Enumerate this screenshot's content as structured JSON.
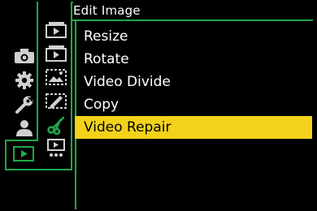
{
  "header": {
    "title": "Edit Image"
  },
  "menu": {
    "items": [
      {
        "label": "Resize"
      },
      {
        "label": "Rotate"
      },
      {
        "label": "Video Divide"
      },
      {
        "label": "Copy"
      },
      {
        "label": "Video Repair"
      }
    ],
    "selected_index": 4
  },
  "left_tabs": [
    {
      "icon": "camera-icon"
    },
    {
      "icon": "gear-icon"
    },
    {
      "icon": "wrench-icon"
    },
    {
      "icon": "person-icon"
    },
    {
      "icon": "playback-icon",
      "active": true
    }
  ],
  "sub_tabs": [
    {
      "icon": "film-stack-icon"
    },
    {
      "icon": "film-stack-alt-icon"
    },
    {
      "icon": "image-edit-icon"
    },
    {
      "icon": "pencil-frame-icon"
    },
    {
      "icon": "scissors-icon",
      "active": true
    },
    {
      "icon": "play-dots-icon"
    }
  ],
  "colors": {
    "accent": "#1fa84a",
    "highlight": "#f2d21b",
    "background": "#000000",
    "icon_gray": "#d0d0d0"
  }
}
